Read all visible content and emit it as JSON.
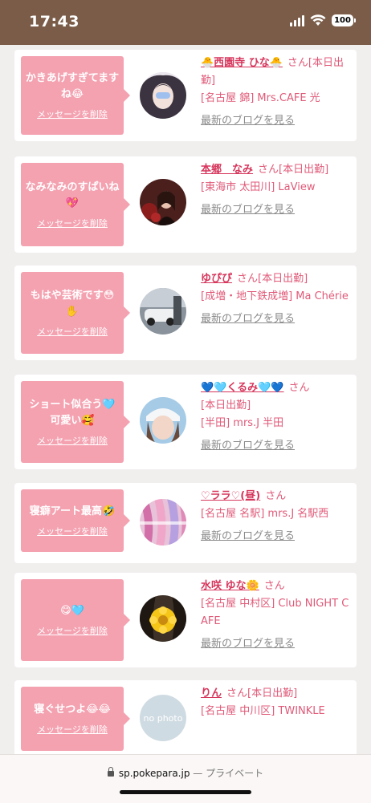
{
  "status_bar": {
    "time": "17:43",
    "battery": "100"
  },
  "cards": [
    {
      "message": "かきあげすぎてますね😂",
      "delete_label": "メッセージを削除",
      "name": "🐣西園寺 ひな🐣",
      "san": "さん",
      "status": "[本日出勤]",
      "shop": "[名古屋 錦] Mrs.CAFE 光",
      "blog": "最新のブログを見る",
      "avatar_color": "#dcd4de"
    },
    {
      "message": "なみなみのすぱいね💖",
      "delete_label": "メッセージを削除",
      "name": "本郷　なみ",
      "san": "さん",
      "status": "[本日出勤]",
      "shop": "[東海市 太田川] LaView",
      "blog": "最新のブログを見る",
      "avatar_color": "#5a2a24"
    },
    {
      "message": "もはや芸術です😳✋",
      "delete_label": "メッセージを削除",
      "name": "ゆぴぴ",
      "san": "さん",
      "status": "[本日出勤]",
      "shop": "[成増・地下鉄成増] Ma Chérie",
      "blog": "最新のブログを見る",
      "avatar_color": "#6d7580"
    },
    {
      "message": "ショート似合う🩵可愛い🥰",
      "delete_label": "メッセージを削除",
      "name": "💙🩵くるみ🩵💙",
      "san": "さん",
      "status": "[本日出勤]",
      "shop": "[半田] mrs.J 半田",
      "blog": "最新のブログを見る",
      "avatar_color": "#9fc3de"
    },
    {
      "message": "寝癖アート最高🤣",
      "delete_label": "メッセージを削除",
      "name": "♡ララ♡(昼)",
      "san": "さん",
      "status": "",
      "shop": "[名古屋 名駅] mrs.J 名駅西",
      "blog": "最新のブログを見る",
      "avatar_color": "#d99cc4"
    },
    {
      "message": "😋🩵",
      "delete_label": "メッセージを削除",
      "name": "水咲 ゆな🌼",
      "san": "さん",
      "status": "",
      "shop": "[名古屋 中村区] Club NIGHT CAFE",
      "blog": "最新のブログを見る",
      "avatar_color": "#3e3228"
    },
    {
      "message": "寝ぐせつよ😂😂",
      "delete_label": "メッセージを削除",
      "name": "りん",
      "san": "さん",
      "status": "[本日出勤]",
      "shop": "[名古屋 中川区] TWINKLE",
      "blog": "",
      "avatar_color": "#cfdbe2",
      "avatar_text": "no photo"
    }
  ],
  "url_bar": {
    "domain": "sp.pokepara.jp",
    "private": "— プライベート"
  }
}
